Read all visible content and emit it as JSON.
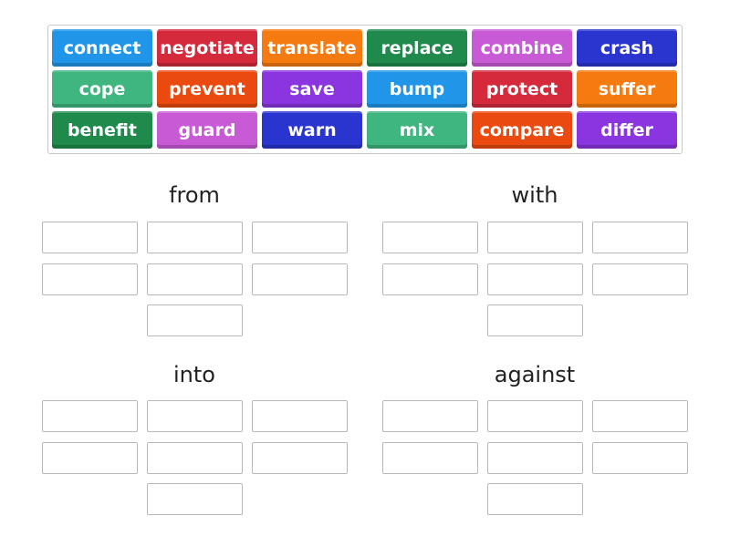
{
  "tiles": [
    {
      "label": "connect",
      "color": "#2196e8"
    },
    {
      "label": "negotiate",
      "color": "#d42a3c"
    },
    {
      "label": "translate",
      "color": "#f57a10"
    },
    {
      "label": "replace",
      "color": "#1f8a4c"
    },
    {
      "label": "combine",
      "color": "#c95ad6"
    },
    {
      "label": "crash",
      "color": "#2a35cf"
    },
    {
      "label": "cope",
      "color": "#3fb57f"
    },
    {
      "label": "prevent",
      "color": "#ea4a10"
    },
    {
      "label": "save",
      "color": "#8a35e0"
    },
    {
      "label": "bump",
      "color": "#2196e8"
    },
    {
      "label": "protect",
      "color": "#d42a3c"
    },
    {
      "label": "suffer",
      "color": "#f57a10"
    },
    {
      "label": "benefit",
      "color": "#1f8a4c"
    },
    {
      "label": "guard",
      "color": "#c95ad6"
    },
    {
      "label": "warn",
      "color": "#2a35cf"
    },
    {
      "label": "mix",
      "color": "#3fb57f"
    },
    {
      "label": "compare",
      "color": "#ea4a10"
    },
    {
      "label": "differ",
      "color": "#8a35e0"
    }
  ],
  "groups": [
    {
      "title": "from",
      "slots": 7
    },
    {
      "title": "with",
      "slots": 7
    },
    {
      "title": "into",
      "slots": 7
    },
    {
      "title": "against",
      "slots": 7
    }
  ]
}
